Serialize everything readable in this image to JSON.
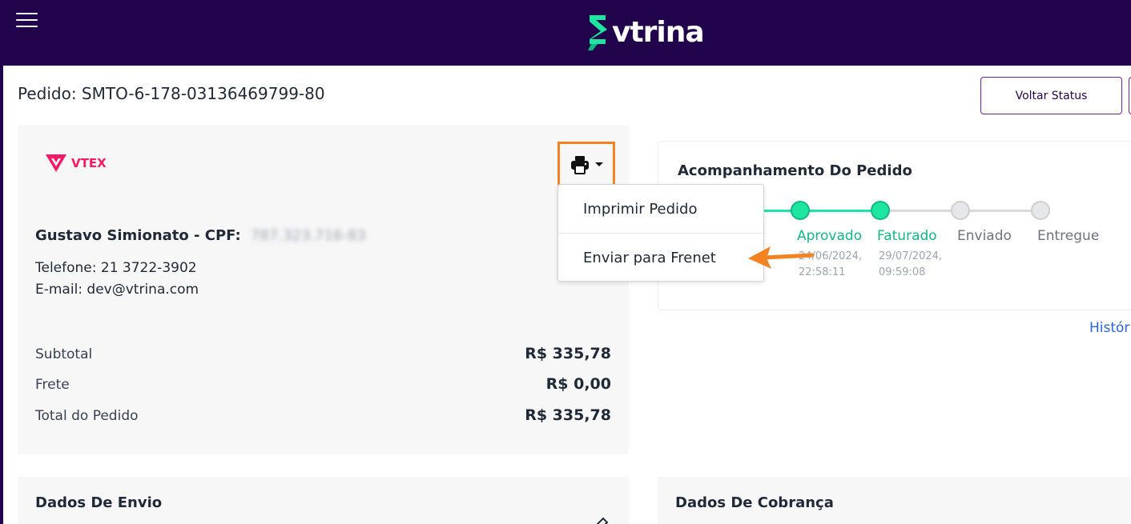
{
  "header": {
    "brand": "vtrina",
    "colors": {
      "background": "#22044d",
      "brand_accent": "#1ce6a0"
    }
  },
  "order": {
    "title": "Pedido: SMTO-6-178-03136469799-80",
    "voltar_status_label": "Voltar Status"
  },
  "summary_card": {
    "marketplace": "VTEX",
    "customer_name": "Gustavo Simionato - CPF:",
    "customer_cpf": "787.323.716-83",
    "phone": "Telefone: 21 3722-3902",
    "email": "E-mail: dev@vtrina.com",
    "totals": [
      {
        "label": "Subtotal",
        "value": "R$ 335,78"
      },
      {
        "label": "Frete",
        "value": "R$ 0,00"
      },
      {
        "label": "Total do Pedido",
        "value": "R$ 335,78"
      }
    ]
  },
  "print_menu": {
    "items": [
      {
        "label": "Imprimir Pedido"
      },
      {
        "label": "Enviar para Frenet"
      }
    ]
  },
  "tracking": {
    "title": "Acompanhamento Do Pedido",
    "steps": [
      {
        "label": "Aprovado",
        "status": "done",
        "date": "24/06/2024,",
        "time": "22:58:11"
      },
      {
        "label": "Faturado",
        "status": "done",
        "date": "29/07/2024,",
        "time": "09:59:08"
      },
      {
        "label": "Enviado",
        "status": "pending"
      },
      {
        "label": "Entregue",
        "status": "pending"
      }
    ],
    "history_link": "Históri"
  },
  "sections": {
    "envio_title": "Dados De Envio",
    "cobranca_title": "Dados De Cobrança"
  }
}
